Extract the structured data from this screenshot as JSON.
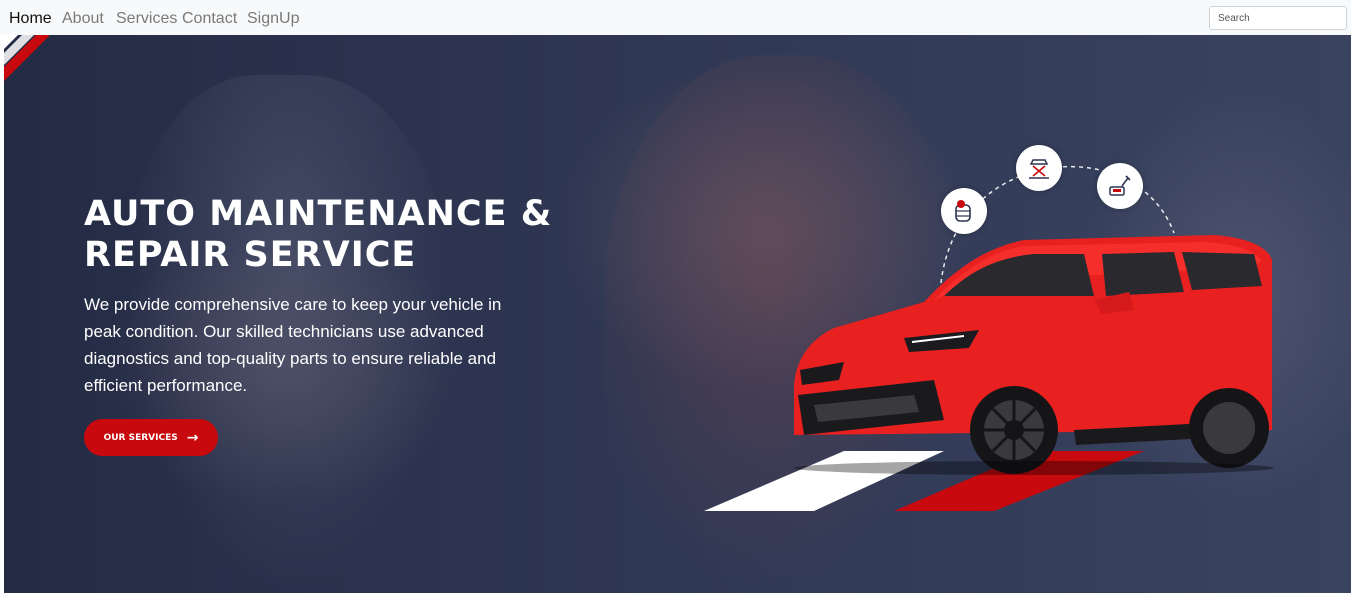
{
  "nav": {
    "items": [
      {
        "label": "Home",
        "active": true
      },
      {
        "label": "About",
        "active": false
      },
      {
        "label": "Services",
        "active": false
      },
      {
        "label": "Contact",
        "active": false
      },
      {
        "label": "SignUp",
        "active": false
      }
    ],
    "search_placeholder": "Search"
  },
  "hero": {
    "title": "AUTO MAINTENANCE & REPAIR SERVICE",
    "description": "We provide comprehensive care to keep your vehicle in peak condition. Our skilled technicians use advanced diagnostics and top-quality parts to ensure reliable and efficient performance.",
    "cta_label": "OUR SERVICES",
    "icons": [
      "tire-service-icon",
      "car-lift-icon",
      "oil-service-icon"
    ]
  },
  "colors": {
    "accent_red": "#c8090d",
    "car_red": "#e8201f",
    "hero_overlay": "#2c3450",
    "navbar_bg": "#f8f9fa"
  }
}
